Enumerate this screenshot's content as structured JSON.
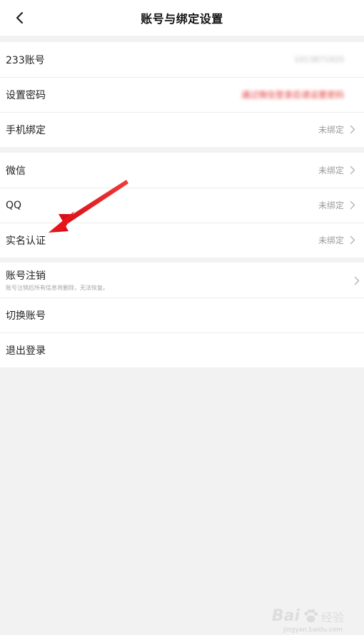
{
  "header": {
    "title": "账号与绑定设置"
  },
  "group1": {
    "account": {
      "label": "233账号",
      "value": "1013871920"
    },
    "password": {
      "label": "设置密码",
      "value": "通过微信登录后请设置密码"
    },
    "phone": {
      "label": "手机绑定",
      "value": "未绑定"
    }
  },
  "group2": {
    "wechat": {
      "label": "微信",
      "value": "未绑定"
    },
    "qq": {
      "label": "QQ",
      "value": "未绑定"
    },
    "realname": {
      "label": "实名认证",
      "value": "未绑定"
    }
  },
  "group3": {
    "cancel": {
      "label": "账号注销",
      "sub": "账号注销后所有信息将删除，无法恢复。"
    },
    "switch": {
      "label": "切换账号"
    },
    "logout": {
      "label": "退出登录"
    }
  },
  "watermark": {
    "brand": "Bai",
    "brand2": "经验",
    "sub": "jingyan.baidu.com"
  },
  "colors": {
    "annotation_arrow": "#e8141b",
    "background": "#f2f2f2",
    "row_value": "#9b9b9b"
  }
}
